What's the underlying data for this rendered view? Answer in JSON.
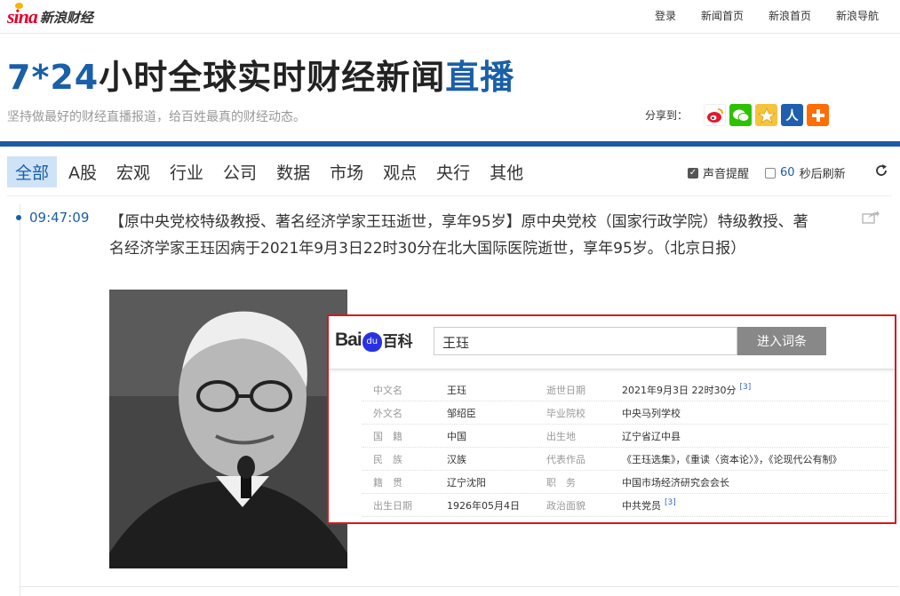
{
  "header": {
    "logo": {
      "brand": "sina",
      "section": "新浪财经"
    },
    "links": [
      "登录",
      "新闻首页",
      "新浪首页",
      "新浪导航"
    ]
  },
  "headline": {
    "part1": "7*24",
    "part2": "小时全球实时财经新闻",
    "part3": "直播"
  },
  "subtitle": "坚持做最好的财经直播报道，给百姓最真的财经动态。",
  "share": {
    "label": "分享到：",
    "icons": [
      "weibo-icon",
      "wechat-icon",
      "qzone-icon",
      "renren-icon",
      "more-share-icon"
    ]
  },
  "nav": {
    "tabs": [
      "全部",
      "A股",
      "宏观",
      "行业",
      "公司",
      "数据",
      "市场",
      "观点",
      "央行",
      "其他"
    ],
    "active": "全部",
    "sound_label": "声音提醒",
    "sound_checked": true,
    "refresh_seconds": "60",
    "refresh_label": "秒后刷新",
    "refresh_checked": false
  },
  "feed": [
    {
      "time": "09:47:09",
      "text": "【原中央党校特级教授、著名经济学家王珏逝世，享年95岁】原中央党校（国家行政学院）特级教授、著名经济学家王珏因病于2021年9月3日22时30分在北大国际医院逝世，享年95岁。（北京日报）"
    }
  ],
  "baike": {
    "logo_text": "Bai",
    "logo_paw": "du",
    "logo_ke": "百科",
    "search_value": "王珏",
    "button": "进入词条",
    "rows": [
      {
        "k1": "中文名",
        "v1": "王珏",
        "k2": "逝世日期",
        "v2": "2021年9月3日 22时30分",
        "ref": "[3]"
      },
      {
        "k1": "外文名",
        "v1": "邹绍臣",
        "k2": "毕业院校",
        "v2": "中央马列学校",
        "ref": ""
      },
      {
        "k1": "国　籍",
        "v1": "中国",
        "k2": "出生地",
        "v2": "辽宁省辽中县",
        "ref": ""
      },
      {
        "k1": "民　族",
        "v1": "汉族",
        "k2": "代表作品",
        "v2": "《王珏选集》，《重读〈资本论〉》，《论现代公有制》",
        "ref": ""
      },
      {
        "k1": "籍　贯",
        "v1": "辽宁沈阳",
        "k2": "职　务",
        "v2": "中国市场经济研究会会长",
        "ref": ""
      },
      {
        "k1": "出生日期",
        "v1": "1926年05月4日",
        "k2": "政治面貌",
        "v2": "中共党员",
        "ref": "[3]"
      }
    ]
  }
}
